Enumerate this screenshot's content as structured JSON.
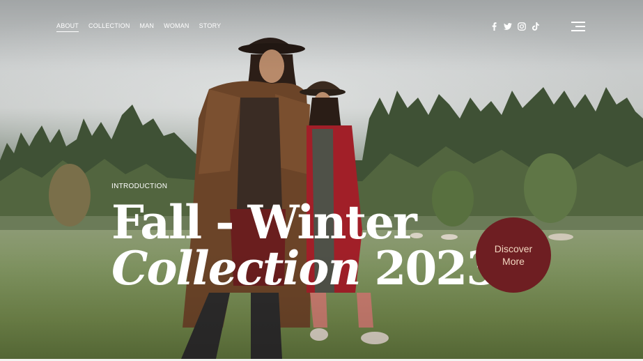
{
  "nav": {
    "items": [
      {
        "label": "ABOUT",
        "active": true
      },
      {
        "label": "COLLECTION",
        "active": false
      },
      {
        "label": "MAN",
        "active": false
      },
      {
        "label": "WOMAN",
        "active": false
      },
      {
        "label": "STORY",
        "active": false
      }
    ]
  },
  "social": [
    "facebook-icon",
    "twitter-icon",
    "instagram-icon",
    "tiktok-icon"
  ],
  "hero": {
    "intro": "INTRODUCTION",
    "title_line1": "Fall - Winter",
    "title_line2_italic": "Collection",
    "title_line2_year": " 2023",
    "cta_line1": "Discover",
    "cta_line2": "More"
  },
  "colors": {
    "accent": "#6e1e22",
    "cta_text": "#f1d6c0",
    "text": "#ffffff"
  }
}
